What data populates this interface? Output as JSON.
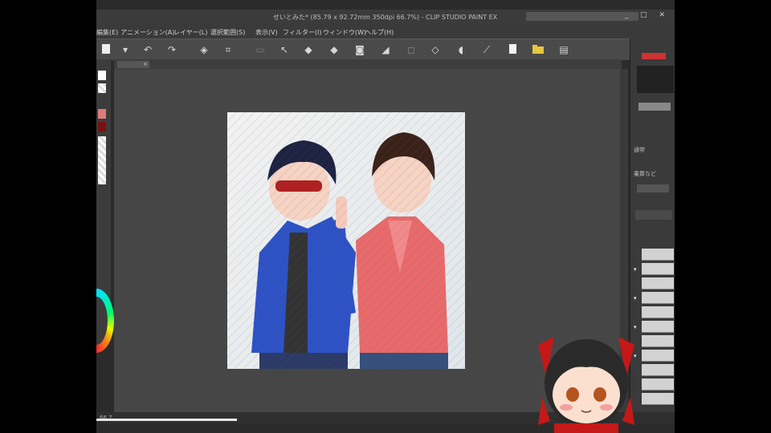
{
  "window": {
    "title": "せいとみた* (85.79 x 92.72mm 350dpi 66.7%) - CLIP STUDIO PAINT EX",
    "controls": "_ □ ✕"
  },
  "menu": {
    "items": [
      "編集(E)",
      "アニメーション(A)",
      "レイヤー(L)",
      "選択範囲(S)",
      "表示(V)",
      "フィルター(I)",
      "ウィンドウ(W)",
      "ヘルプ(H)"
    ]
  },
  "toolbar": {
    "icons": [
      "new-file-icon",
      "dropdown-icon",
      "undo-icon",
      "redo-icon",
      "clear-icon",
      "transform-icon",
      "crop-icon",
      "cursor-icon",
      "fill-icon",
      "fill-select-icon",
      "select-icon",
      "deselect-icon",
      "select-all-icon",
      "invert-select-icon",
      "fill-layer-icon",
      "pin-icon",
      "page-icon",
      "folder-icon",
      "printer-icon"
    ]
  },
  "canvas_tab": {
    "close": "×"
  },
  "right_panel": {
    "labels": [
      "通常",
      "乗算など"
    ]
  },
  "status": {
    "zoom": "66.7"
  },
  "colors": {
    "app_bg": "#2b2b2b",
    "canvas_bg": "#464646",
    "toolbar_bg": "#4a4a4a",
    "accent_red": "#8b1a1a"
  }
}
